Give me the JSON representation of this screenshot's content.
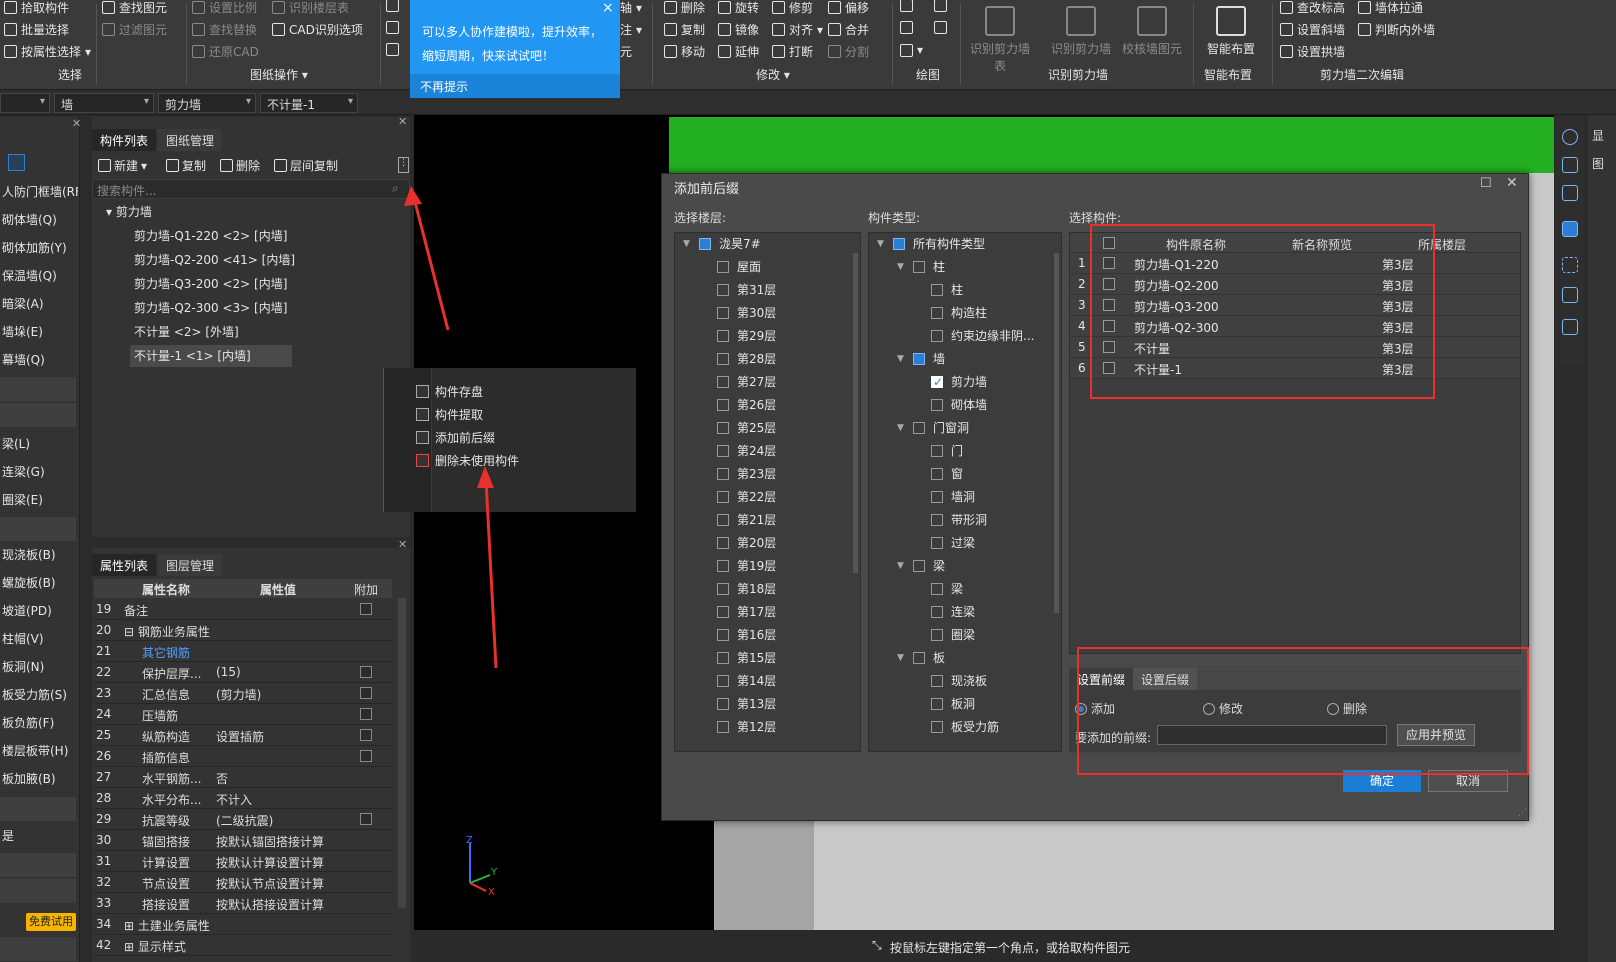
{
  "ribbon": {
    "select_group": {
      "items": [
        "拾取构件",
        "批量选择",
        "按属性选择"
      ],
      "label": "选择"
    },
    "find_group": {
      "items": [
        "查找图元",
        "过滤图元"
      ]
    },
    "drawing_ops": {
      "items": [
        "设置比例",
        "识别楼层表",
        "查找替换",
        "CAD识别选项",
        "还原CAD"
      ],
      "label": "图纸操作"
    },
    "modify_group": {
      "items": [
        "删除",
        "旋转",
        "修剪",
        "偏移",
        "复制",
        "镜像",
        "对齐",
        "合并",
        "移动",
        "延伸",
        "打断",
        "分割"
      ],
      "label": "修改"
    },
    "draw_label": "绘图",
    "identify_shear": {
      "buttons": [
        "识别剪力墙表",
        "识别剪力墙",
        "校核墙图元"
      ],
      "label": "识别剪力墙"
    },
    "smart_layout": {
      "button": "智能布置",
      "label": "智能布置"
    },
    "shear_edit": {
      "items": [
        "查改标高",
        "墙体拉通",
        "设置斜墙",
        "判断内外墙",
        "设置拱墙"
      ],
      "label": "剪力墙二次编辑"
    },
    "partial": [
      "轴",
      "注",
      "元"
    ]
  },
  "filterbar": {
    "sel1": "",
    "sel2": "墙",
    "sel3": "剪力墙",
    "sel4": "不计量-1"
  },
  "tooltip": {
    "text": "可以多人协作建模啦，提升效率，缩短周期，快来试试吧！",
    "dismiss": "不再提示",
    "close": "×"
  },
  "leftnav": {
    "items": [
      "人防门框墙(RF",
      "砌体墙(Q)",
      "砌体加筋(Y)",
      "保温墙(Q)",
      "暗梁(A)",
      "墙垛(E)",
      "幕墙(Q)",
      "梁(L)",
      "连梁(G)",
      "圈梁(E)",
      "现浇板(B)",
      "螺旋板(B)",
      "坡道(PD)",
      "柱帽(V)",
      "板洞(N)",
      "板受力筋(S)",
      "板负筋(F)",
      "楼层板带(H)",
      "板加腋(B)",
      "是"
    ],
    "trial_badge": "免费试用"
  },
  "component_panel": {
    "tabs": [
      "构件列表",
      "图纸管理"
    ],
    "toolbar": [
      "新建",
      "复制",
      "删除",
      "层间复制"
    ],
    "search_placeholder": "搜索构件...",
    "tree_root": "剪力墙",
    "tree_items": [
      "剪力墙-Q1-220 <2> [内墙]",
      "剪力墙-Q2-200 <41> [内墙]",
      "剪力墙-Q3-200 <2> [内墙]",
      "剪力墙-Q2-300 <3> [内墙]",
      "不计量 <2> [外墙]",
      "不计量-1 <1> [内墙]"
    ]
  },
  "context_menu": {
    "items": [
      "构件存盘",
      "构件提取",
      "添加前后缀",
      "删除未使用构件"
    ]
  },
  "property_panel": {
    "tabs": [
      "属性列表",
      "图层管理"
    ],
    "headers": [
      "属性名称",
      "属性值",
      "附加"
    ],
    "rows": [
      {
        "n": "19",
        "name": "备注",
        "value": "",
        "check": true
      },
      {
        "n": "20",
        "name": "⊟ 钢筋业务属性",
        "value": "",
        "check": false
      },
      {
        "n": "21",
        "name": "其它钢筋",
        "value": "",
        "check": false,
        "link": true
      },
      {
        "n": "22",
        "name": "保护层厚...",
        "value": "(15)",
        "check": true
      },
      {
        "n": "23",
        "name": "汇总信息",
        "value": "(剪力墙)",
        "check": true
      },
      {
        "n": "24",
        "name": "压墙筋",
        "value": "",
        "check": true
      },
      {
        "n": "25",
        "name": "纵筋构造",
        "value": "设置插筋",
        "check": true
      },
      {
        "n": "26",
        "name": "插筋信息",
        "value": "",
        "check": true
      },
      {
        "n": "27",
        "name": "水平钢筋...",
        "value": "否",
        "check": false
      },
      {
        "n": "28",
        "name": "水平分布...",
        "value": "不计入",
        "check": false
      },
      {
        "n": "29",
        "name": "抗震等级",
        "value": "(二级抗震)",
        "check": true
      },
      {
        "n": "30",
        "name": "锚固搭接",
        "value": "按默认锚固搭接计算",
        "check": false
      },
      {
        "n": "31",
        "name": "计算设置",
        "value": "按默认计算设置计算",
        "check": false
      },
      {
        "n": "32",
        "name": "节点设置",
        "value": "按默认节点设置计算",
        "check": false
      },
      {
        "n": "33",
        "name": "搭接设置",
        "value": "按默认搭接设置计算",
        "check": false
      },
      {
        "n": "34",
        "name": "⊞ 土建业务属性",
        "value": "",
        "check": false
      },
      {
        "n": "42",
        "name": "⊞ 显示样式",
        "value": "",
        "check": false
      }
    ]
  },
  "dialog": {
    "title": "添加前后缀",
    "floor_label": "选择楼层:",
    "type_label": "构件类型:",
    "comp_label": "选择构件:",
    "floor_root": "泷昊7#",
    "floors": [
      "屋面",
      "第31层",
      "第30层",
      "第29层",
      "第28层",
      "第27层",
      "第26层",
      "第25层",
      "第24层",
      "第23层",
      "第22层",
      "第21层",
      "第20层",
      "第19层",
      "第18层",
      "第17层",
      "第16层",
      "第15层",
      "第14层",
      "第13层",
      "第12层"
    ],
    "types": [
      {
        "label": "所有构件类型",
        "level": 0,
        "state": "blue"
      },
      {
        "label": "柱",
        "level": 1,
        "state": "off"
      },
      {
        "label": "柱",
        "level": 2,
        "state": "off"
      },
      {
        "label": "构造柱",
        "level": 2,
        "state": "off"
      },
      {
        "label": "约束边缘非阴...",
        "level": 2,
        "state": "off"
      },
      {
        "label": "墙",
        "level": 1,
        "state": "blue"
      },
      {
        "label": "剪力墙",
        "level": 2,
        "state": "on"
      },
      {
        "label": "砌体墙",
        "level": 2,
        "state": "off"
      },
      {
        "label": "门窗洞",
        "level": 1,
        "state": "off"
      },
      {
        "label": "门",
        "level": 2,
        "state": "off"
      },
      {
        "label": "窗",
        "level": 2,
        "state": "off"
      },
      {
        "label": "墙洞",
        "level": 2,
        "state": "off"
      },
      {
        "label": "带形洞",
        "level": 2,
        "state": "off"
      },
      {
        "label": "过梁",
        "level": 2,
        "state": "off"
      },
      {
        "label": "梁",
        "level": 1,
        "state": "off"
      },
      {
        "label": "梁",
        "level": 2,
        "state": "off"
      },
      {
        "label": "连梁",
        "level": 2,
        "state": "off"
      },
      {
        "label": "圈梁",
        "level": 2,
        "state": "off"
      },
      {
        "label": "板",
        "level": 1,
        "state": "off"
      },
      {
        "label": "现浇板",
        "level": 2,
        "state": "off"
      },
      {
        "label": "板洞",
        "level": 2,
        "state": "off"
      },
      {
        "label": "板受力筋",
        "level": 2,
        "state": "off"
      }
    ],
    "grid_headers": [
      "构件原名称",
      "新名称预览",
      "所属楼层"
    ],
    "grid_rows": [
      {
        "n": "1",
        "name": "剪力墙-Q1-220",
        "preview": "",
        "floor": "第3层"
      },
      {
        "n": "2",
        "name": "剪力墙-Q2-200",
        "preview": "",
        "floor": "第3层"
      },
      {
        "n": "3",
        "name": "剪力墙-Q3-200",
        "preview": "",
        "floor": "第3层"
      },
      {
        "n": "4",
        "name": "剪力墙-Q2-300",
        "preview": "",
        "floor": "第3层"
      },
      {
        "n": "5",
        "name": "不计量",
        "preview": "",
        "floor": "第3层"
      },
      {
        "n": "6",
        "name": "不计量-1",
        "preview": "",
        "floor": "第3层"
      }
    ],
    "tabs": [
      "设置前缀",
      "设置后缀"
    ],
    "radios": [
      "添加",
      "修改",
      "删除"
    ],
    "prefix_label": "要添加的前缀:",
    "prefix_value": "",
    "apply_btn": "应用并预览",
    "ok_btn": "确定",
    "cancel_btn": "取消"
  },
  "status": {
    "hint": "按鼠标左键指定第一个角点，或拾取构件图元"
  },
  "right_edge": {
    "labels": [
      "显",
      "图"
    ]
  },
  "colors": {
    "accent": "#2196f3",
    "green": "#22b020",
    "annotation_red": "#e8302c"
  }
}
